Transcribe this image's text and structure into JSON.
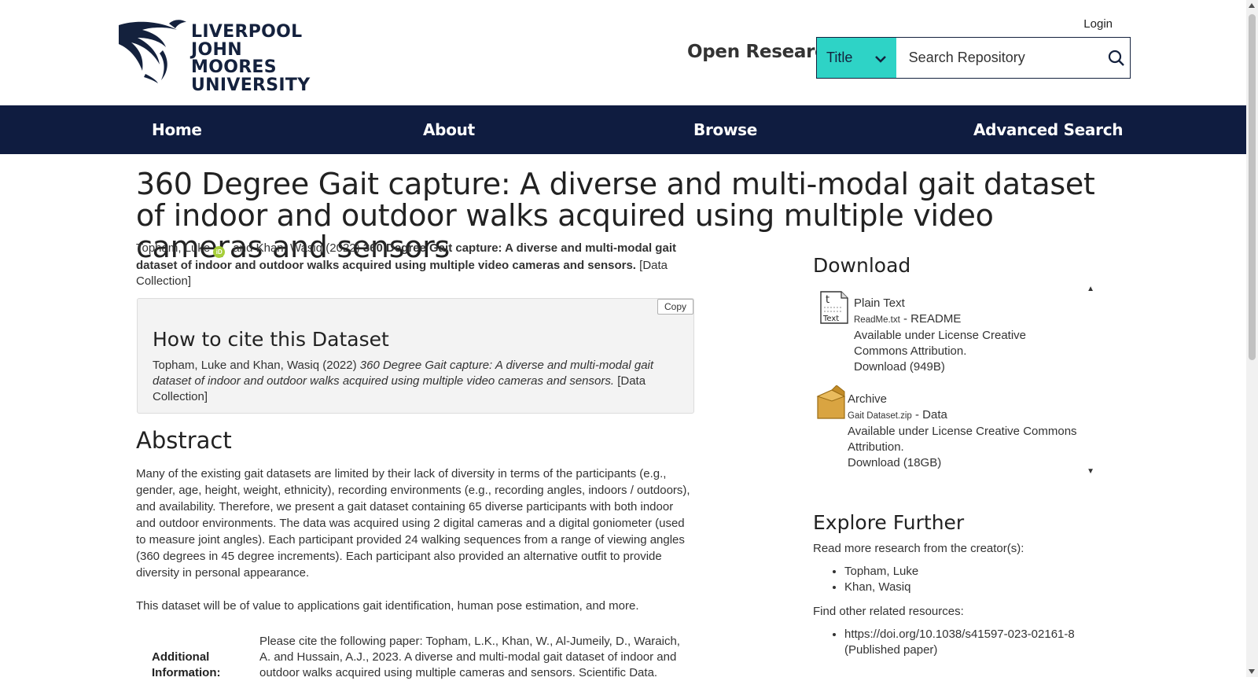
{
  "header": {
    "logo_lines": [
      "LIVERPOOL",
      "JOHN MOORES",
      "UNIVERSITY"
    ],
    "login": "Login",
    "site_name": "Open Research",
    "search": {
      "field_selected": "Title",
      "placeholder": "Search Repository"
    }
  },
  "nav": {
    "items": [
      {
        "label": "Home"
      },
      {
        "label": "About"
      },
      {
        "label": "Browse"
      },
      {
        "label": "Advanced Search"
      }
    ]
  },
  "record": {
    "title": "360 Degree Gait capture: A diverse and multi-modal gait dataset of indoor and outdoor walks acquired using multiple video cameras and sensors",
    "author1": "Topham, Luke",
    "orcid_label": "iD",
    "and": "and",
    "author2": "Khan, Wasiq",
    "year": "(2022)",
    "title_bold": "360 Degree Gait capture: A diverse and multi-modal gait dataset of indoor and outdoor walks acquired using multiple video cameras and sensors.",
    "type": "[Data Collection]"
  },
  "cite_box": {
    "copy_label": "Copy",
    "heading": "How to cite this Dataset",
    "authors_year": "Topham, Luke and Khan, Wasiq (2022)",
    "title_italic": "360 Degree Gait capture: A diverse and multi-modal gait dataset of indoor and outdoor walks acquired using multiple video cameras and sensors.",
    "type": "[Data Collection]"
  },
  "abstract": {
    "heading": "Abstract",
    "p1": "Many of the existing gait datasets are limited by their lack of diversity in terms of the participants (e.g., gender, age, height, weight, ethnicity), recording environments (e.g., recording angles, indoors / outdoors), and availability. Therefore, we present a gait dataset containing 65 diverse participants with both indoor and outdoor environments. The data was acquired using 2 digital cameras and a digital goniometer (used to measure joint angles). Each participant provided 24 walking sequences from a range of viewing angles (360 degrees in 45 degree increments). Each participant also provided an alternative outfit to provide diversity in personal appearance.",
    "p2": "This dataset will be of value to applications gait identification, human pose estimation, and more."
  },
  "additional_info": {
    "label": "Additional Information:",
    "value": "Please cite the following paper: Topham, L.K., Khan, W., Al-Jumeily, D., Waraich, A. and Hussain, A.J., 2023. A diverse and multi-modal gait dataset of indoor and outdoor walks acquired using multiple cameras and sensors. Scientific Data."
  },
  "download": {
    "heading": "Download",
    "items": [
      {
        "icon": "text-file-icon",
        "icon_text_top": "t",
        "icon_text_bottom": "Text",
        "format": "Plain Text",
        "filename": "ReadMe.txt",
        "desc": "- README",
        "license": "Available under License Creative Commons Attribution.",
        "download": "Download (949B)"
      },
      {
        "icon": "archive-box-icon",
        "format": "Archive",
        "filename": "Gait Dataset.zip",
        "desc": "- Data",
        "license": "Available under License Creative Commons Attribution.",
        "download": "Download (18GB)"
      }
    ]
  },
  "explore": {
    "heading": "Explore Further",
    "creators_intro": "Read more research from the creator(s):",
    "creators": [
      "Topham, Luke",
      "Khan, Wasiq"
    ],
    "related_intro": "Find other related resources:",
    "related_link": "https://doi.org/10.1038/s41597-023-02161-8",
    "related_note": "(Published paper)"
  },
  "colors": {
    "nav_bg": "#0f1c40",
    "search_select_bg": "#2ed3c6",
    "orcid": "#a6ce39"
  }
}
